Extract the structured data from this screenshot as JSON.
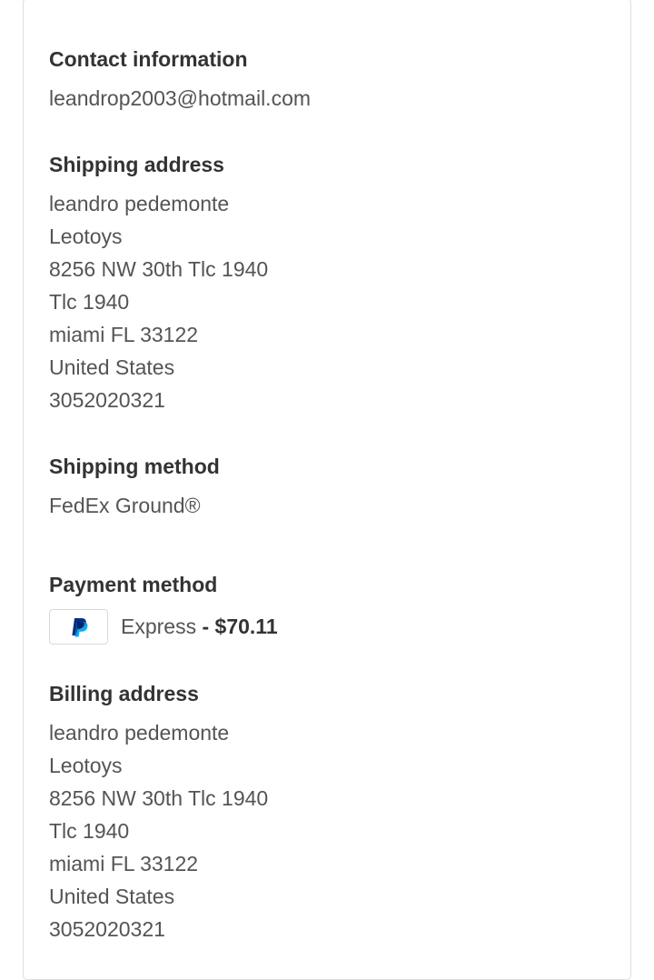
{
  "contact": {
    "heading": "Contact information",
    "email": "leandrop2003@hotmail.com"
  },
  "shipping_address": {
    "heading": "Shipping address",
    "lines": [
      "leandro pedemonte",
      "Leotoys",
      "8256 NW 30th Tlc 1940",
      "Tlc 1940",
      "miami FL 33122",
      "United States",
      "3052020321"
    ]
  },
  "shipping_method": {
    "heading": "Shipping method",
    "value": "FedEx Ground®"
  },
  "payment_method": {
    "heading": "Payment method",
    "icon": "paypal-icon",
    "label": "Express",
    "separator": " - ",
    "amount": "$70.11",
    "colors": {
      "paypal_dark": "#003087",
      "paypal_light": "#009cde"
    }
  },
  "billing_address": {
    "heading": "Billing address",
    "lines": [
      "leandro pedemonte",
      "Leotoys",
      "8256 NW 30th Tlc 1940",
      "Tlc 1940",
      "miami FL 33122",
      "United States",
      "3052020321"
    ]
  }
}
